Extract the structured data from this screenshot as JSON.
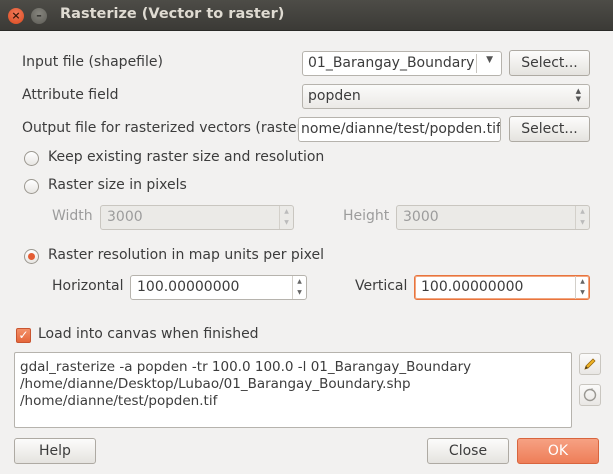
{
  "window": {
    "title": "Rasterize (Vector to raster)",
    "close_glyph": "×",
    "minimize_glyph": "–"
  },
  "input_file": {
    "label": "Input file (shapefile)",
    "value": "01_Barangay_Boundary",
    "select_label": "Select..."
  },
  "attribute_field": {
    "label": "Attribute field",
    "value": "popden"
  },
  "output_file": {
    "label": "Output file for rasterized vectors (raster)",
    "value": "nome/dianne/test/popden.tif",
    "select_label": "Select..."
  },
  "size_options": {
    "keep_label": "Keep existing raster size and resolution",
    "pixels_label": "Raster size in pixels",
    "width_label": "Width",
    "width_value": "3000",
    "height_label": "Height",
    "height_value": "3000",
    "resolution_label": "Raster resolution in map units per pixel",
    "horizontal_label": "Horizontal",
    "horizontal_value": "100.00000000",
    "vertical_label": "Vertical",
    "vertical_value": "100.00000000",
    "selected": "resolution"
  },
  "load_canvas": {
    "label": "Load into canvas when finished",
    "checked": true
  },
  "command": {
    "line1": "gdal_rasterize -a popden -tr 100.0 100.0 -l 01_Barangay_Boundary",
    "line2": "/home/dianne/Desktop/Lubao/01_Barangay_Boundary.shp",
    "line3": "/home/dianne/test/popden.tif"
  },
  "icons": {
    "edit": "pencil-icon",
    "reset": "reset-icon"
  },
  "buttons": {
    "help": "Help",
    "close": "Close",
    "ok": "OK"
  },
  "colors": {
    "accent": "#e45d34",
    "ok_button": "#f08a64",
    "titlebar": "#3c3b37"
  }
}
